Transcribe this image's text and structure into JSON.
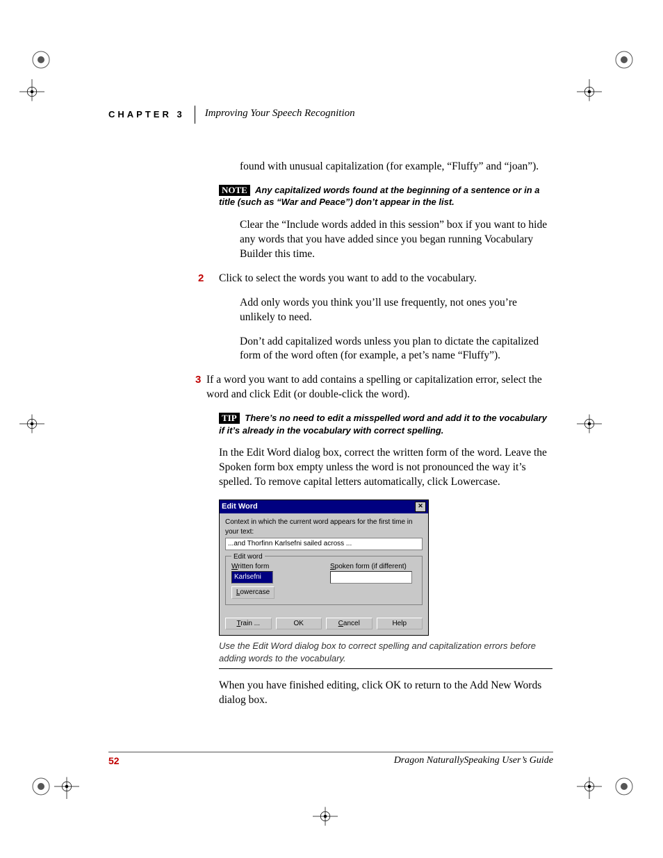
{
  "header": {
    "chapter": "CHAPTER 3",
    "title": "Improving Your Speech Recognition"
  },
  "intro_tail": "found with unusual capitalization (for example, “Fluffy” and “joan”).",
  "note": {
    "badge": "NOTE",
    "text": "Any capitalized words found at the beginning of a sentence or in a title (such as “War and Peace”) don’t appear in the list."
  },
  "after_note": "Clear the “Include words added in this session” box if you want to hide any words that you have added since you began running Vocabulary Builder this time.",
  "step2": {
    "num": "2",
    "line": "Click to select the words you want to add to the vocabulary.",
    "p1": "Add only words you think you’ll use frequently, not ones you’re unlikely to need.",
    "p2": "Don’t add capitalized words unless you plan to dictate the capitalized form of the word often (for example, a pet’s name “Fluffy”)."
  },
  "step3": {
    "num": "3",
    "line": "If a word you want to add contains a spelling or capitalization error, select the word and click Edit (or double-click the word)."
  },
  "tip": {
    "badge": "TIP",
    "text": "There’s no need to edit a misspelled word and add it to the vocabulary if it’s already in the vocabulary with correct spelling."
  },
  "para_after_tip": "In the Edit Word dialog box, correct the written form of the word. Leave the Spoken form box empty unless the word is not pronounced the way it’s spelled. To remove capital letters automatically, click Lowercase.",
  "dialog": {
    "title": "Edit Word",
    "context_label": "Context in which the current word appears for the first time in your text:",
    "context_value": "...and Thorfinn Karlsefni sailed across ...",
    "group": "Edit word",
    "written_label": "Written form",
    "written_value": "Karlsefni",
    "spoken_label": "Spoken form (if different)",
    "spoken_value": "",
    "lowercase": "Lowercase",
    "train": "Train ...",
    "ok": "OK",
    "cancel": "Cancel",
    "help": "Help"
  },
  "caption": "Use the Edit Word dialog box to correct spelling and capitalization errors before adding words to the vocabulary.",
  "closing": "When you have finished editing, click OK to return to the Add New Words dialog box.",
  "footer": {
    "page": "52",
    "guide": "Dragon NaturallySpeaking User’s Guide"
  }
}
